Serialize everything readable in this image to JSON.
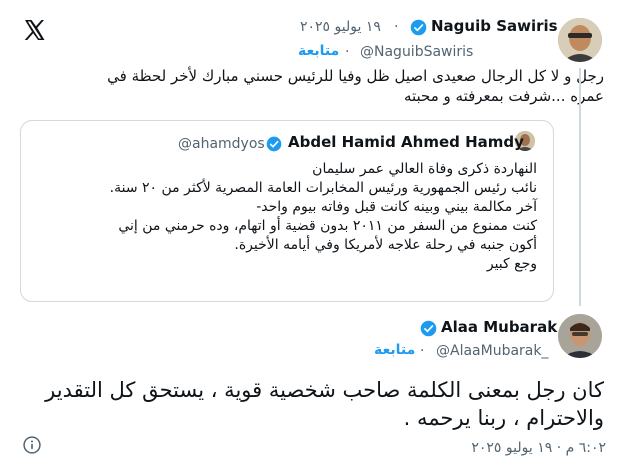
{
  "icons": {
    "logo": "x-logo-icon",
    "verified": "verified-badge-icon",
    "info": "info-icon"
  },
  "colors": {
    "accent": "#1d9bf0",
    "muted": "#536471",
    "border": "#cfd9de"
  },
  "parent_tweet": {
    "author_name": "Naguib Sawiris",
    "dot": "·",
    "date": "١٩ يوليو ٢٠٢٥",
    "handle": "@NaguibSawiris",
    "follow_label": "متابعة",
    "text_line1": "رجل و لا كل الرجال صعيدى اصيل ظل وفيا للرئيس حسني مبارك لأخر لحظة في",
    "text_line2": "عمره ...شرفت بمعرفته و محبته"
  },
  "quoted_tweet": {
    "author_name": "Abdel Hamid Ahmed Hamdy",
    "handle": "@ahamdyos",
    "lines": [
      "النهاردة ذكرى وفاة العالي عمر سليمان",
      "نائب رئيس الجمهورية ورئيس المخابرات العامة المصرية لأكثر من ٢٠ سنة.",
      "آخر مكالمة بيني وبينه كانت قبل وفاته بيوم واحد-",
      "كنت ممنوع من السفر من ٢٠١١ بدون قضية أو اتهام، وده حرمني من إني",
      "أكون جنبه في رحلة علاجه لأمريكا وفي أيامه الأخيرة.",
      "وجع كبير"
    ]
  },
  "main_tweet": {
    "author_name": "Alaa Mubarak",
    "handle": "@AlaaMubarak_",
    "follow_label": "متابعة",
    "text_line1": "كان رجل بمعنى الكلمة صاحب شخصية قوية ، يستحق كل التقدير",
    "text_line2": "والاحترام ، ربنا يرحمه .",
    "timestamp": "٦:٠٢ م · ١٩ يوليو ٢٠٢٥"
  }
}
